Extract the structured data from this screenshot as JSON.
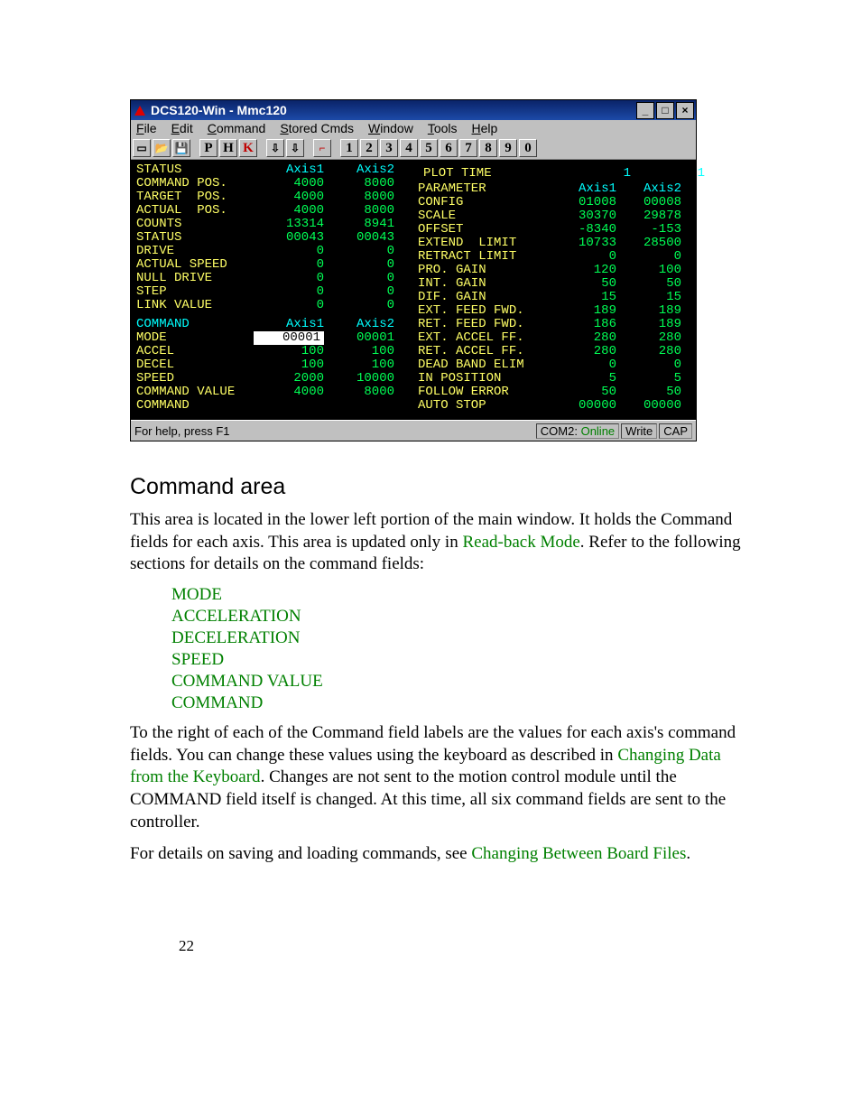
{
  "window": {
    "title": "DCS120-Win - Mmc120"
  },
  "menu": [
    "File",
    "Edit",
    "Command",
    "Stored Cmds",
    "Window",
    "Tools",
    "Help"
  ],
  "toolbar_letters": [
    "P",
    "H",
    "K"
  ],
  "toolbar_numbers": [
    "1",
    "2",
    "3",
    "4",
    "5",
    "6",
    "7",
    "8",
    "9",
    "0"
  ],
  "plot": {
    "label": "PLOT TIME",
    "v1": "1",
    "v2": "1"
  },
  "status_table": {
    "hdr": {
      "label": "STATUS",
      "a1": "Axis1",
      "a2": "Axis2"
    },
    "rows": [
      {
        "label": "COMMAND POS.",
        "a1": "4000",
        "a2": "8000"
      },
      {
        "label": "TARGET  POS.",
        "a1": "4000",
        "a2": "8000"
      },
      {
        "label": "ACTUAL  POS.",
        "a1": "4000",
        "a2": "8000"
      },
      {
        "label": "COUNTS",
        "a1": "13314",
        "a2": "8941"
      },
      {
        "label": "STATUS",
        "a1": "00043",
        "a2": "00043"
      },
      {
        "label": "DRIVE",
        "a1": "0",
        "a2": "0"
      },
      {
        "label": "ACTUAL SPEED",
        "a1": "0",
        "a2": "0"
      },
      {
        "label": "NULL DRIVE",
        "a1": "0",
        "a2": "0"
      },
      {
        "label": "STEP",
        "a1": "0",
        "a2": "0"
      },
      {
        "label": "LINK VALUE",
        "a1": "0",
        "a2": "0"
      }
    ]
  },
  "command_table": {
    "hdr": {
      "label": "COMMAND",
      "a1": "Axis1",
      "a2": "Axis2"
    },
    "rows": [
      {
        "label": "MODE",
        "a1": "00001",
        "a2": "00001",
        "sel": true
      },
      {
        "label": "ACCEL",
        "a1": "100",
        "a2": "100"
      },
      {
        "label": "DECEL",
        "a1": "100",
        "a2": "100"
      },
      {
        "label": "SPEED",
        "a1": "2000",
        "a2": "10000"
      },
      {
        "label": "COMMAND VALUE",
        "a1": "4000",
        "a2": "8000"
      },
      {
        "label": "COMMAND",
        "a1": "",
        "a2": ""
      }
    ]
  },
  "param_table": {
    "hdr": {
      "label": "PARAMETER",
      "a1": "Axis1",
      "a2": "Axis2"
    },
    "rows": [
      {
        "label": "CONFIG",
        "a1": "01008",
        "a2": "00008"
      },
      {
        "label": "SCALE",
        "a1": "30370",
        "a2": "29878"
      },
      {
        "label": "OFFSET",
        "a1": "-8340",
        "a2": "-153"
      },
      {
        "label": "EXTEND  LIMIT",
        "a1": "10733",
        "a2": "28500"
      },
      {
        "label": "RETRACT LIMIT",
        "a1": "0",
        "a2": "0"
      },
      {
        "label": "PRO. GAIN",
        "a1": "120",
        "a2": "100"
      },
      {
        "label": "INT. GAIN",
        "a1": "50",
        "a2": "50"
      },
      {
        "label": "DIF. GAIN",
        "a1": "15",
        "a2": "15"
      },
      {
        "label": "EXT. FEED FWD.",
        "a1": "189",
        "a2": "189"
      },
      {
        "label": "RET. FEED FWD.",
        "a1": "186",
        "a2": "189"
      },
      {
        "label": "EXT. ACCEL FF.",
        "a1": "280",
        "a2": "280"
      },
      {
        "label": "RET. ACCEL FF.",
        "a1": "280",
        "a2": "280"
      },
      {
        "label": "DEAD BAND ELIM",
        "a1": "0",
        "a2": "0"
      },
      {
        "label": "IN POSITION",
        "a1": "5",
        "a2": "5"
      },
      {
        "label": "FOLLOW ERROR",
        "a1": "50",
        "a2": "50"
      },
      {
        "label": "AUTO STOP",
        "a1": "00000",
        "a2": "00000"
      }
    ]
  },
  "statusbar": {
    "help": "For help, press F1",
    "port": "COM2:",
    "online": "Online",
    "write": "Write",
    "cap": "CAP"
  },
  "doc": {
    "heading": "Command area",
    "para1a": "This area is located in the lower left portion of the main window.  It holds the Command fields for each axis.  This area is updated only in ",
    "link1": "Read-back Mode",
    "para1b": ".  Refer to the following sections for details on the command fields:",
    "links": [
      "MODE",
      "ACCELERATION",
      "DECELERATION",
      "SPEED",
      "COMMAND VALUE",
      "COMMAND"
    ],
    "para2a": "To the right of each of the Command field labels are the values for each axis's command fields.  You can change these values using the keyboard as described in ",
    "link2": "Changing Data from the Keyboard",
    "para2b": ".  Changes are not sent to the motion control module until the COMMAND field itself is changed.  At this time, all six command fields are sent to the controller.",
    "para3a": "For details on saving and loading commands, see ",
    "link3": "Changing Between Board Files",
    "para3b": ".",
    "page": "22"
  }
}
